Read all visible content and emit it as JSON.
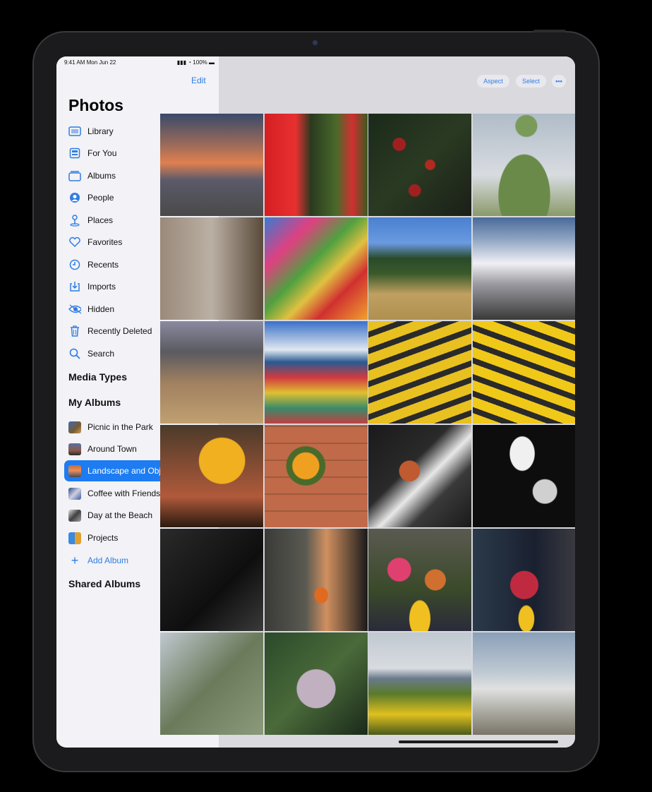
{
  "status": {
    "time": "9:41 AM  Mon Jun 22",
    "right": "100%"
  },
  "sidebar": {
    "edit_label": "Edit",
    "title": "Photos",
    "items": [
      {
        "label": "Library",
        "icon": "photo-library-icon"
      },
      {
        "label": "For You",
        "icon": "for-you-icon"
      },
      {
        "label": "Albums",
        "icon": "albums-icon"
      },
      {
        "label": "People",
        "icon": "people-icon"
      },
      {
        "label": "Places",
        "icon": "places-pin-icon"
      },
      {
        "label": "Favorites",
        "icon": "heart-icon"
      },
      {
        "label": "Recents",
        "icon": "clock-icon"
      },
      {
        "label": "Imports",
        "icon": "import-icon"
      },
      {
        "label": "Hidden",
        "icon": "eye-icon"
      },
      {
        "label": "Recently Deleted",
        "icon": "trash-icon"
      },
      {
        "label": "Search",
        "icon": "search-icon"
      }
    ],
    "media_types": "Media Types",
    "my_albums": "My Albums",
    "albums": [
      {
        "label": "Picnic in the Park"
      },
      {
        "label": "Around Town"
      },
      {
        "label": "Landscape and Objects",
        "selected": true
      },
      {
        "label": "Coffee with Friends"
      },
      {
        "label": "Day at the Beach"
      },
      {
        "label": "Projects"
      }
    ],
    "add_album": "Add Album",
    "shared_albums": "Shared Albums"
  },
  "toolbar": {
    "aspect": "Aspect",
    "select": "Select",
    "more": "•••"
  },
  "colors": {
    "accent": "#2f7de1",
    "selected_bg": "#1d7cf2"
  },
  "photos": [
    {
      "name": "sunset-city"
    },
    {
      "name": "red-pants-flowers"
    },
    {
      "name": "red-berries"
    },
    {
      "name": "cactus"
    },
    {
      "name": "plant-wall"
    },
    {
      "name": "papel-picado"
    },
    {
      "name": "hay-field"
    },
    {
      "name": "snowy-mountains"
    },
    {
      "name": "dry-grass"
    },
    {
      "name": "stadium-seats-wide"
    },
    {
      "name": "yellow-seats-1"
    },
    {
      "name": "yellow-seats-2"
    },
    {
      "name": "yellow-flowers"
    },
    {
      "name": "flower-bouquet-tiles"
    },
    {
      "name": "flowers-shadow"
    },
    {
      "name": "teacup"
    },
    {
      "name": "dark-corner"
    },
    {
      "name": "person-bottle"
    },
    {
      "name": "flower-market"
    },
    {
      "name": "flower-pot"
    },
    {
      "name": "green-fabric"
    },
    {
      "name": "succulent"
    },
    {
      "name": "yellow-shrubs-sea"
    },
    {
      "name": "balustrade"
    }
  ]
}
